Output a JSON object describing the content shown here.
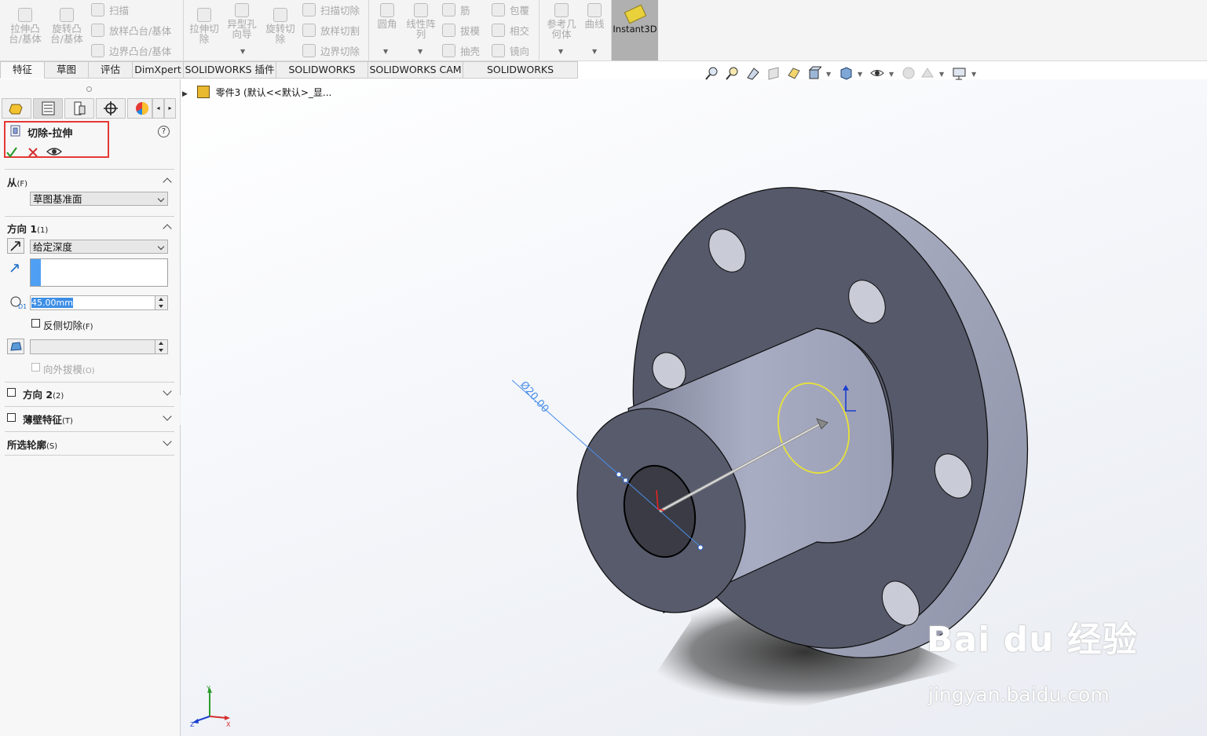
{
  "ribbon": {
    "extrude_boss": "拉伸凸\n台/基体",
    "revolve_boss": "旋转凸\n台/基体",
    "sweep": "扫描",
    "loft_boss": "放样凸台/基体",
    "boundary_boss": "边界凸台/基体",
    "extrude_cut": "拉伸切\n除",
    "hole_wizard": "异型孔\n向导",
    "revolve_cut": "旋转切\n除",
    "swept_cut": "扫描切除",
    "lofted_cut": "放样切割",
    "boundary_cut": "边界切除",
    "fillet": "圆角",
    "linear_pattern": "线性阵\n列",
    "rib": "筋",
    "draft": "拔模",
    "shell": "抽壳",
    "wrap": "包覆",
    "intersect": "相交",
    "mirror": "镜向",
    "reference_geometry": "参考几\n何体",
    "curves": "曲线",
    "instant3d": "Instant3D"
  },
  "tabs": [
    "特征",
    "草图",
    "评估",
    "DimXpert",
    "SOLIDWORKS 插件",
    "SOLIDWORKS MBD",
    "SOLIDWORKS CAM",
    "SOLIDWORKS Inspection"
  ],
  "tree": {
    "part_label": "零件3  (默认<<默认>_显..."
  },
  "property_manager": {
    "title": "切除-拉伸",
    "help": "?",
    "from": {
      "heading": "从",
      "heading_key": "(F)",
      "value": "草图基准面"
    },
    "direction1": {
      "heading": "方向 1",
      "heading_key": "(1)",
      "end_condition": "给定深度",
      "depth": "45.00mm",
      "flip_side_label": "反侧切除",
      "flip_side_key": "(F)",
      "draft_value": "",
      "draft_outward_label": "向外拔模",
      "draft_outward_key": "(O)"
    },
    "direction2": {
      "heading": "方向 2",
      "heading_key": "(2)"
    },
    "thin_feature": {
      "heading": "薄壁特征",
      "heading_key": "(T)"
    },
    "selected_contours": {
      "heading": "所选轮廓",
      "heading_key": "(S)"
    }
  },
  "viewport": {
    "dimension_label": "Ø20.00",
    "triad": {
      "x": "X",
      "y": "Y",
      "z": "Z"
    }
  },
  "watermark": {
    "text": "Bai du 经验",
    "url": "jingyan.baidu.com"
  },
  "colors": {
    "highlight_box": "#e53935",
    "accept": "#2e9b2e",
    "cancel": "#d32f2f",
    "model_dark": "#55596a",
    "model_light": "#a3a7bd",
    "sketch": "#e8e23a"
  }
}
